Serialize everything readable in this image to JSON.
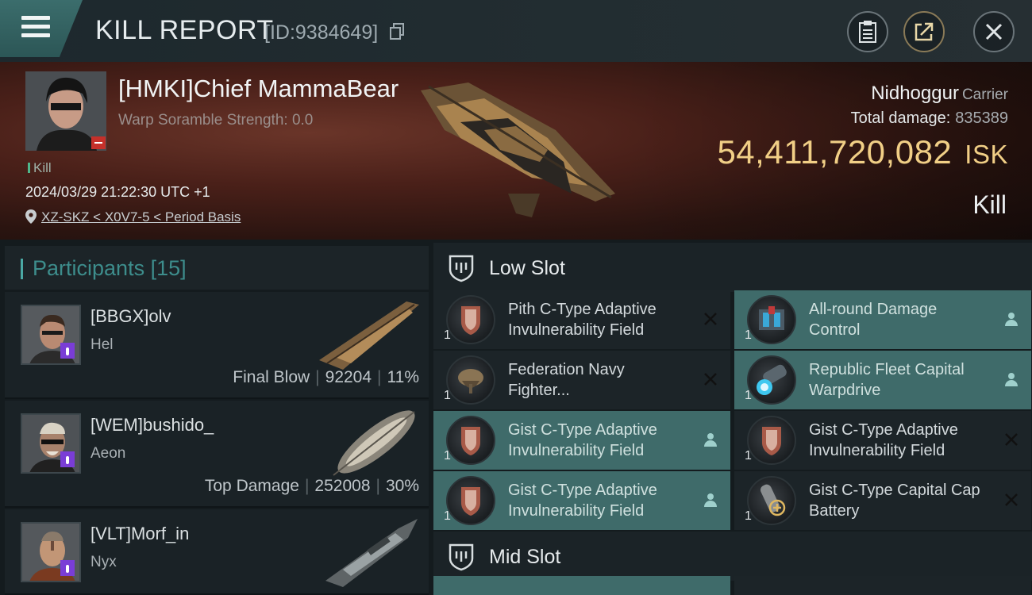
{
  "header": {
    "title": "KILL REPORT",
    "report_id": "[ID:9384649]"
  },
  "victim": {
    "name": "[HMKI]Chief MammaBear",
    "scramble": "Warp Soramble Strength: 0.0",
    "kill_tag": "Kill",
    "datetime": "2024/03/29 21:22:30 UTC +1",
    "location": "XZ-SKZ < X0V7-5 < Period Basis",
    "ship_name": "Nidhoggur",
    "ship_class": "Carrier",
    "total_damage_label": "Total damage:",
    "total_damage": "835389",
    "isk_value": "54,411,720,082",
    "isk_unit": "ISK",
    "result": "Kill"
  },
  "participants": {
    "title": "Participants [15]",
    "rows": [
      {
        "name": "[BBGX]olv",
        "ship": "Hel",
        "stat_label": "Final Blow",
        "damage": "92204",
        "percent": "11%"
      },
      {
        "name": "[WEM]bushido_",
        "ship": "Aeon",
        "stat_label": "Top Damage",
        "damage": "252008",
        "percent": "30%"
      },
      {
        "name": "[VLT]Morf_in",
        "ship": "Nyx"
      }
    ]
  },
  "low_slot": {
    "title": "Low Slot",
    "items": [
      {
        "qty": "1",
        "name": "Pith C-Type Adaptive Invulnerability Field",
        "status": "destroyed"
      },
      {
        "qty": "1",
        "name": "All-round Damage Control",
        "status": "dropped"
      },
      {
        "qty": "1",
        "name": "Federation Navy Fighter...",
        "status": "destroyed"
      },
      {
        "qty": "1",
        "name": "Republic Fleet Capital Warpdrive",
        "status": "dropped"
      },
      {
        "qty": "1",
        "name": "Gist C-Type Adaptive Invulnerability Field",
        "status": "dropped"
      },
      {
        "qty": "1",
        "name": "Gist C-Type Adaptive Invulnerability Field",
        "status": "destroyed"
      },
      {
        "qty": "1",
        "name": "Gist C-Type Adaptive Invulnerability Field",
        "status": "dropped"
      },
      {
        "qty": "1",
        "name": "Gist C-Type Capital Cap Battery",
        "status": "destroyed"
      }
    ]
  },
  "mid_slot": {
    "title": "Mid Slot"
  },
  "colors": {
    "accent": "#3f6b6a",
    "isk": "#f1cf86",
    "kill_green": "#4fb78b"
  }
}
